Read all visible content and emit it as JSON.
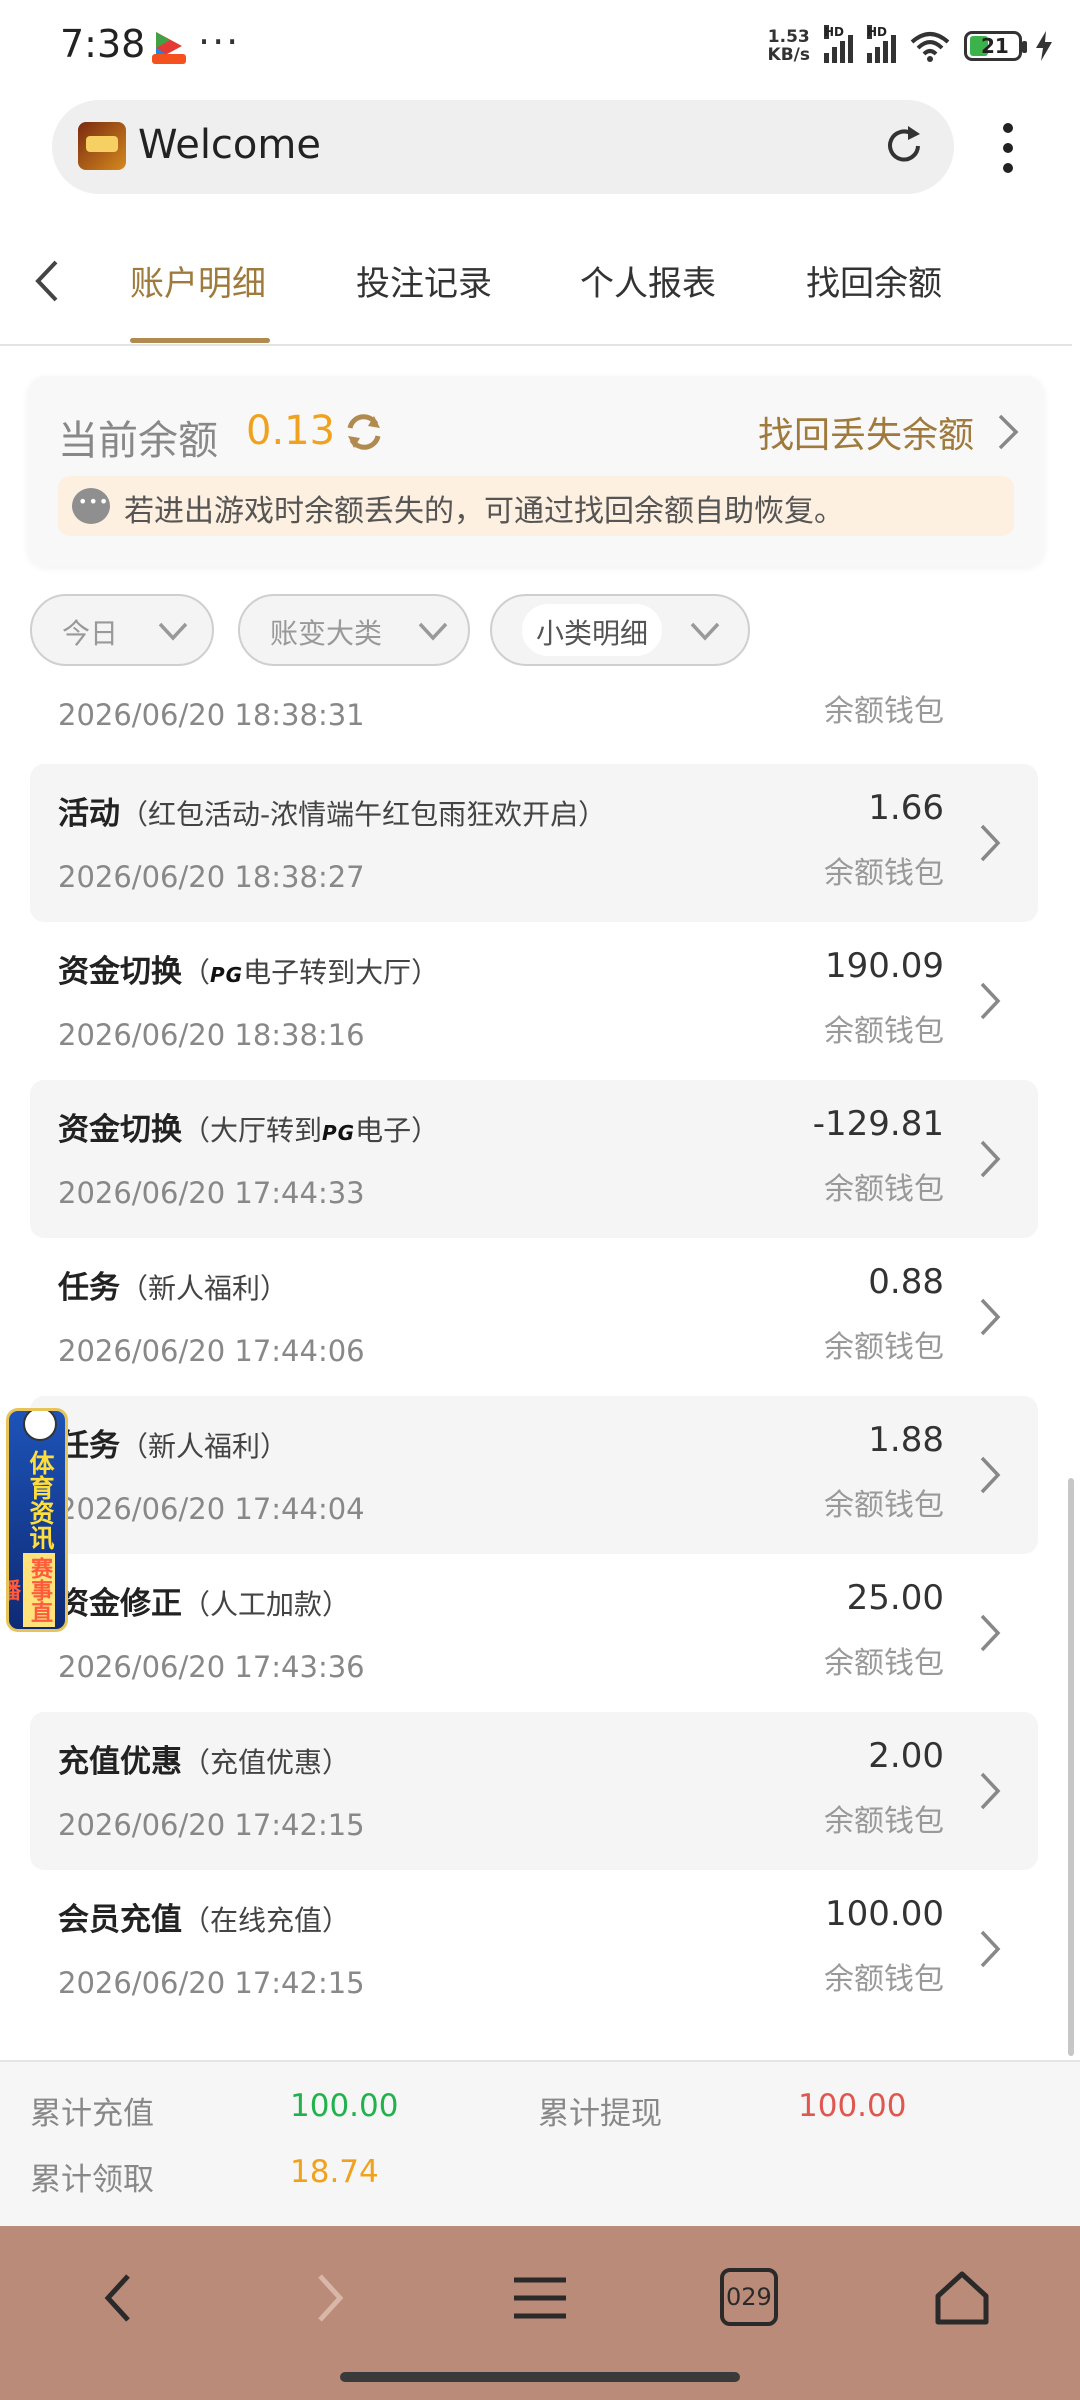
{
  "status": {
    "time": "7:38",
    "more": "···",
    "speed_value": "1.53",
    "speed_unit": "KB/s",
    "hd1": "HD",
    "hd2": "HD",
    "battery": "21"
  },
  "browser": {
    "title": "Welcome"
  },
  "tabs": [
    {
      "label": "账户明细",
      "active": true
    },
    {
      "label": "投注记录"
    },
    {
      "label": "个人报表"
    },
    {
      "label": "找回余额"
    }
  ],
  "balance": {
    "label": "当前余额",
    "value": "0.13",
    "recover_link": "找回丢失余额",
    "notice": "若进出游戏时余额丢失的，可通过找回余额自助恢复。"
  },
  "filters": [
    {
      "label": "今日"
    },
    {
      "label": "账变大类"
    },
    {
      "label": "小类明细"
    }
  ],
  "partial_row": {
    "date": "2026/06/20 18:38:31",
    "wallet": "余额钱包"
  },
  "rows": [
    {
      "type": "活动",
      "sub": "（红包活动-浓情端午红包雨狂欢开启）",
      "date": "2026/06/20 18:38:27",
      "amount": "1.66",
      "wallet": "余额钱包"
    },
    {
      "type": "资金切换",
      "sub_pre": "（",
      "pg": "PG",
      "sub_post": "电子转到大厅）",
      "date": "2026/06/20 18:38:16",
      "amount": "190.09",
      "wallet": "余额钱包"
    },
    {
      "type": "资金切换",
      "sub_pre": "（大厅转到",
      "pg": "PG",
      "sub_post": "电子）",
      "date": "2026/06/20 17:44:33",
      "amount": "-129.81",
      "wallet": "余额钱包"
    },
    {
      "type": "任务",
      "sub": "（新人福利）",
      "date": "2026/06/20 17:44:06",
      "amount": "0.88",
      "wallet": "余额钱包"
    },
    {
      "type": "任务",
      "sub": "（新人福利）",
      "date": "2026/06/20 17:44:04",
      "amount": "1.88",
      "wallet": "余额钱包"
    },
    {
      "type": "资金修正",
      "sub": "（人工加款）",
      "date": "2026/06/20 17:43:36",
      "amount": "25.00",
      "wallet": "余额钱包"
    },
    {
      "type": "充值优惠",
      "sub": "（充值优惠）",
      "date": "2026/06/20 17:42:15",
      "amount": "2.00",
      "wallet": "余额钱包"
    },
    {
      "type": "会员充值",
      "sub": "（在线充值）",
      "date": "2026/06/20 17:42:15",
      "amount": "100.00",
      "wallet": "余额钱包"
    }
  ],
  "sports_badge": {
    "line1": "体育资讯",
    "line2": "赛事直播"
  },
  "summary": {
    "recharge_label": "累计充值",
    "recharge_value": "100.00",
    "withdraw_label": "累计提现",
    "withdraw_value": "100.00",
    "claim_label": "累计领取",
    "claim_value": "18.74",
    "colors": {
      "recharge": "#22b24c",
      "withdraw": "#e0574f",
      "claim": "#f0a21e"
    }
  },
  "navbar": {
    "tabs_count": "029"
  },
  "colors": {
    "accent": "#a07a3c",
    "balance": "#f0a21e",
    "navbar": "#b98b78"
  }
}
